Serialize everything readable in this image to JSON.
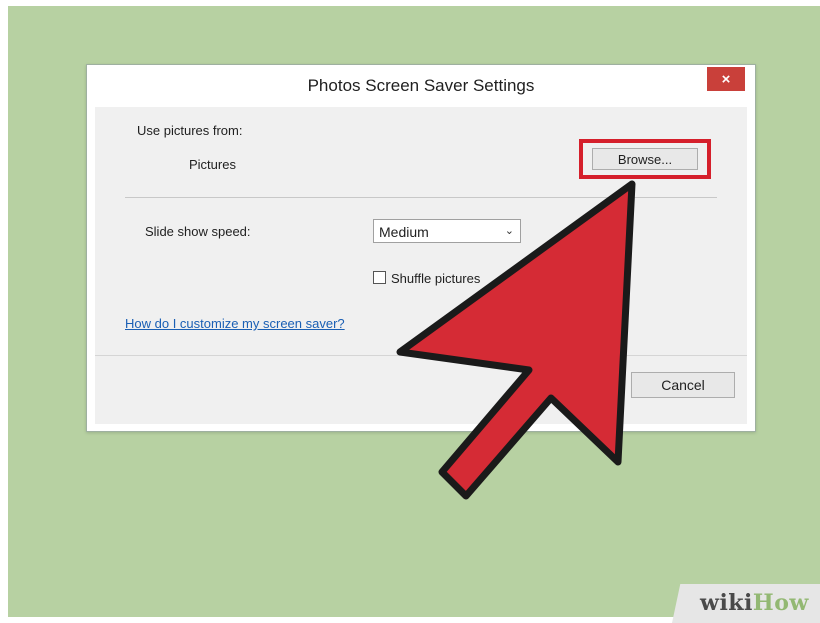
{
  "dialog": {
    "title": "Photos Screen Saver Settings",
    "close_label": "×",
    "use_pictures_label": "Use pictures from:",
    "pictures_value": "Pictures",
    "browse_label": "Browse...",
    "speed_label": "Slide show speed:",
    "speed_value": "Medium",
    "speed_chevron": "⌄",
    "shuffle_label": "Shuffle pictures",
    "help_link": "How do I customize my screen saver?",
    "cancel_label": "Cancel"
  },
  "overlay": {
    "arrow_color": "#d52b35",
    "highlight_color": "#d51f2b"
  },
  "watermark": {
    "wiki": "wiki",
    "how": "How"
  }
}
